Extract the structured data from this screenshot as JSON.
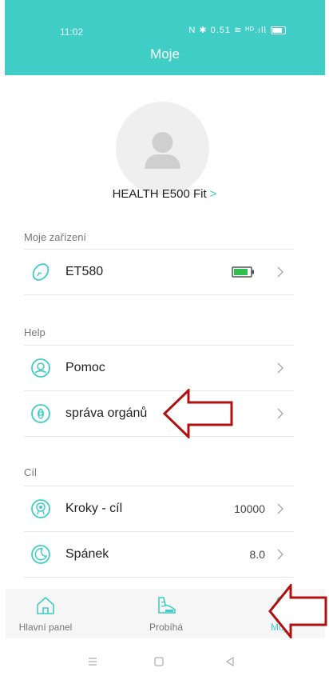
{
  "status_bar": {
    "time": "11:02",
    "icons_text": "N ✱ 0.51 ≋ ᴴᴰ.ıll"
  },
  "header": {
    "title": "Moje"
  },
  "profile": {
    "name": "HEALTH E500 Fit",
    "chevron": ">"
  },
  "sections": {
    "devices": {
      "label": "Moje zařízení",
      "items": [
        {
          "label": "ET580",
          "icon": "watch-icon",
          "battery": "full"
        }
      ]
    },
    "help": {
      "label": "Help",
      "items": [
        {
          "label": "Pomoc",
          "icon": "support-icon"
        },
        {
          "label": "správa orgánů",
          "icon": "organ-management-icon"
        }
      ]
    },
    "goal": {
      "label": "Cíl",
      "items": [
        {
          "label": "Kroky - cíl",
          "value": "10000",
          "icon": "steps-goal-icon"
        },
        {
          "label": "Spánek",
          "value": "8.0",
          "icon": "sleep-icon"
        }
      ]
    }
  },
  "tabs": [
    {
      "label": "Hlavní panel",
      "icon": "home-icon"
    },
    {
      "label": "Probíhá",
      "icon": "running-shoe-icon"
    },
    {
      "label": "Moje",
      "icon": "person-icon",
      "active": true
    }
  ],
  "colors": {
    "accent": "#3fcdc6",
    "annotation_arrow": "#b01010"
  }
}
